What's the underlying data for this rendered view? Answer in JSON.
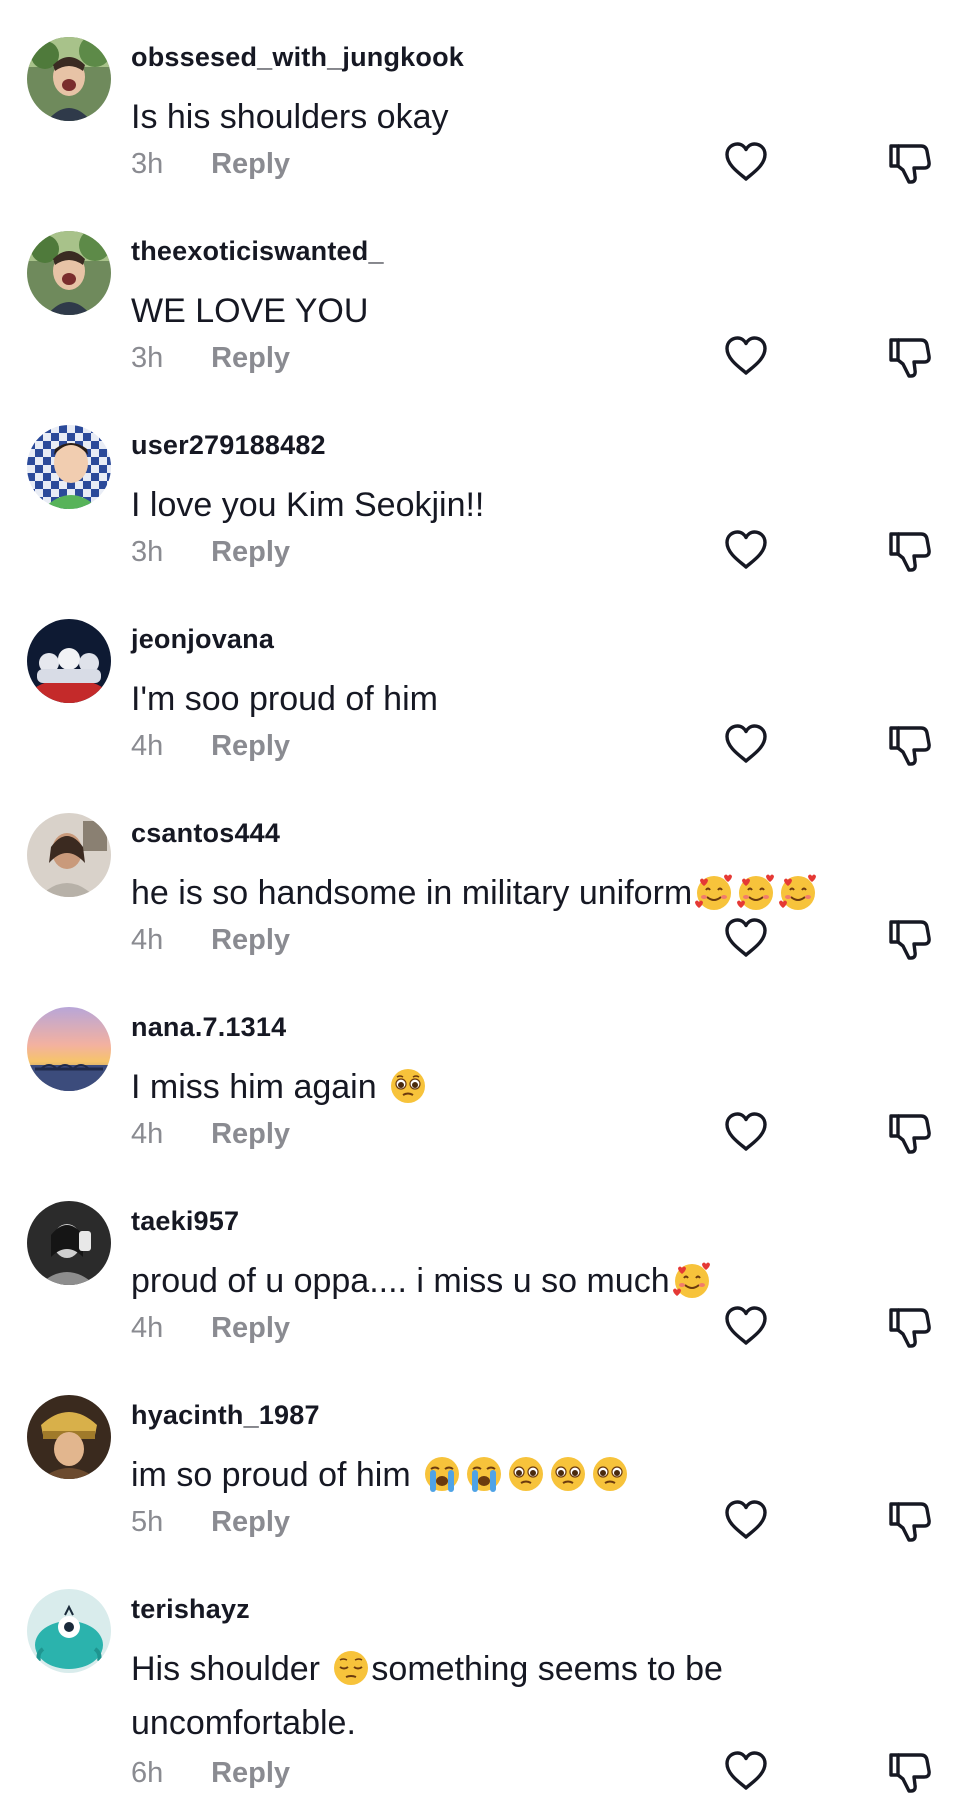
{
  "reply_label": "Reply",
  "comments": [
    {
      "username": "obssesed_with_jungkook",
      "text": "Is his shoulders okay",
      "emojis": [],
      "time": "3h"
    },
    {
      "username": "theexoticiswanted_",
      "text": "WE LOVE YOU",
      "emojis": [],
      "time": "3h"
    },
    {
      "username": "user279188482",
      "text": "I love you Kim Seokjin!!",
      "emojis": [],
      "time": "3h"
    },
    {
      "username": "jeonjovana",
      "text": "I'm soo proud of him",
      "emojis": [],
      "time": "4h"
    },
    {
      "username": "csantos444",
      "text": "he is so handsome in military uniform",
      "emojis": [
        "smiling-face-with-hearts",
        "smiling-face-with-hearts",
        "smiling-face-with-hearts"
      ],
      "time": "4h"
    },
    {
      "username": "nana.7.1314",
      "text": "I miss him again ",
      "emojis": [
        "pleading-face"
      ],
      "time": "4h"
    },
    {
      "username": "taeki957",
      "text": "proud of u oppa.... i miss u so much",
      "emojis": [
        "smiling-face-with-hearts"
      ],
      "time": "4h"
    },
    {
      "username": "hyacinth_1987",
      "text": "im so proud of him ",
      "emojis": [
        "loudly-crying-face",
        "loudly-crying-face",
        "pleading-face",
        "pleading-face",
        "pleading-face"
      ],
      "time": "5h"
    },
    {
      "username": "terishayz",
      "text_before": "His shoulder ",
      "text_after": "something seems to be uncomfortable.",
      "emojis": [
        "pensive-face"
      ],
      "time": "6h"
    }
  ],
  "icons": {
    "like": "heart-outline-icon",
    "dislike": "thumbs-down-outline-icon"
  },
  "colors": {
    "text": "#161823",
    "secondary": "#8a8b91",
    "background": "#ffffff"
  }
}
